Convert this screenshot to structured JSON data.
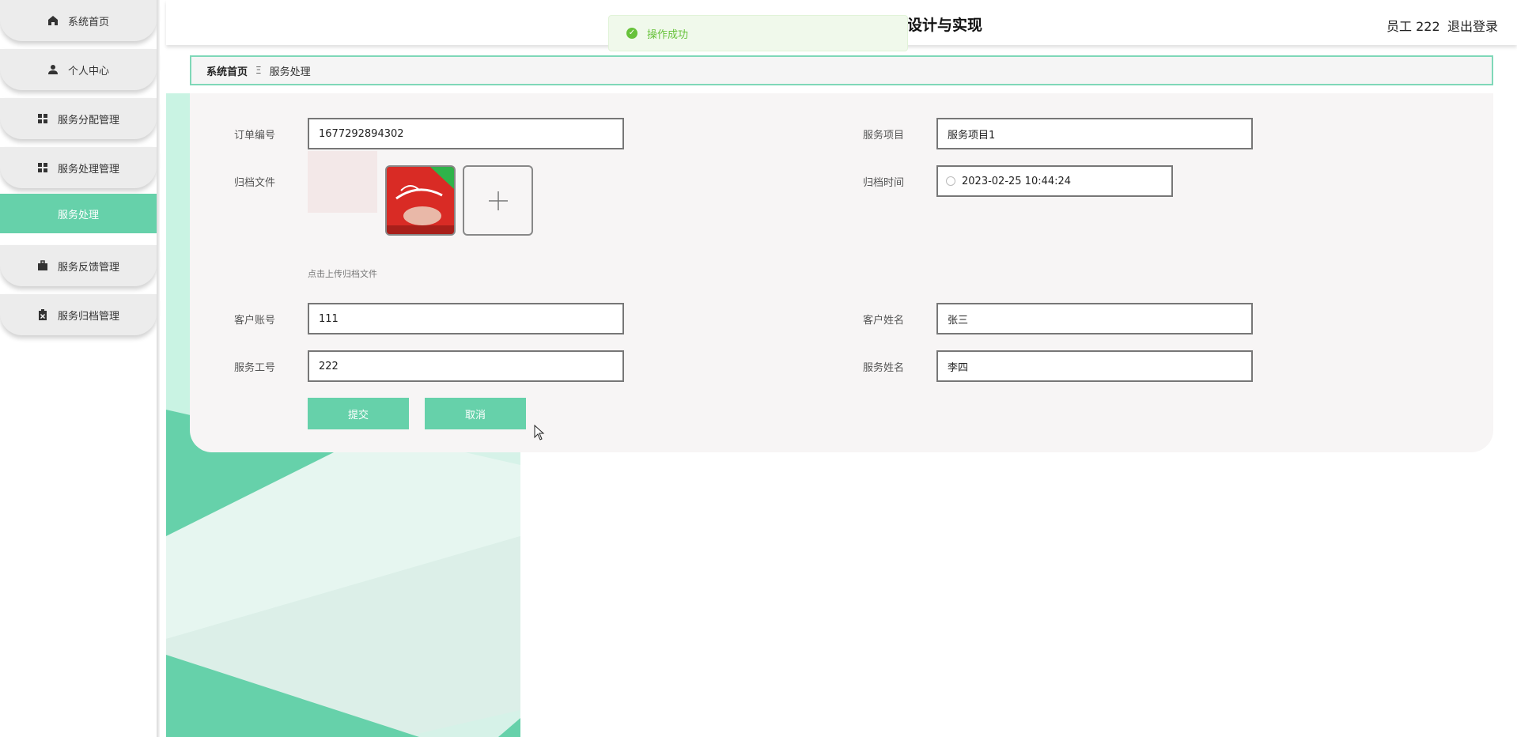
{
  "header": {
    "title": "设计与实现",
    "user": "员工 222",
    "logout": "退出登录"
  },
  "toast": {
    "message": "操作成功"
  },
  "sidebar": {
    "items": [
      {
        "label": "系统首页",
        "icon": "home-icon"
      },
      {
        "label": "个人中心",
        "icon": "user-icon"
      },
      {
        "label": "服务分配管理",
        "icon": "grid-icon"
      },
      {
        "label": "服务处理管理",
        "icon": "grid-icon"
      },
      {
        "label": "服务处理",
        "icon": ""
      },
      {
        "label": "服务反馈管理",
        "icon": "briefcase-icon"
      },
      {
        "label": "服务归档管理",
        "icon": "clipboard-icon"
      }
    ]
  },
  "breadcrumb": {
    "home": "系统首页",
    "separator": "Ξ",
    "current": "服务处理"
  },
  "form": {
    "order_no_label": "订单编号",
    "order_no": "1677292894302",
    "service_item_label": "服务项目",
    "service_item": "服务项目1",
    "archive_file_label": "归档文件",
    "upload_tip": "点击上传归档文件",
    "archive_time_label": "归档时间",
    "archive_time": "2023-02-25 10:44:24",
    "customer_account_label": "客户账号",
    "customer_account": "111",
    "customer_name_label": "客户姓名",
    "customer_name": "张三",
    "staff_no_label": "服务工号",
    "staff_no": "222",
    "staff_name_label": "服务姓名",
    "staff_name": "李四",
    "submit_label": "提交",
    "cancel_label": "取消"
  },
  "colors": {
    "accent": "#66d1aa",
    "toast_text": "#67c23a",
    "toast_bg": "#f0f9eb"
  }
}
